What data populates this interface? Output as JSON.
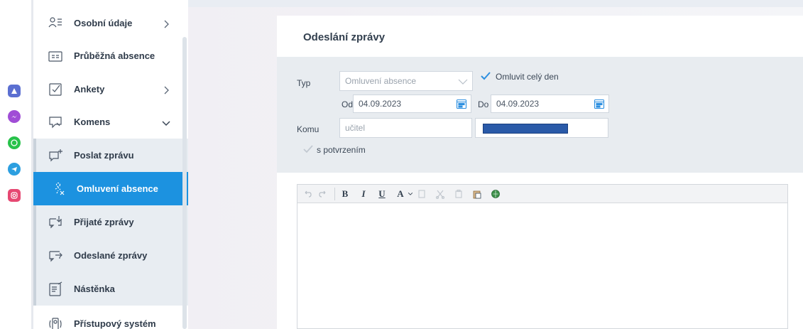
{
  "dock": {
    "apps": [
      {
        "icon": "app-launcher-icon",
        "color": "#5b6fd1"
      },
      {
        "icon": "messenger-icon",
        "color": "#a04dd6"
      },
      {
        "icon": "whatsapp-icon",
        "color": "#27c24a"
      },
      {
        "icon": "telegram-icon",
        "color": "#2c9fe0"
      },
      {
        "icon": "instagram-icon",
        "color": "#e64872"
      }
    ]
  },
  "sidebar": {
    "items": [
      {
        "label": "Osobní údaje",
        "icon": "person-card-icon"
      },
      {
        "label": "Průběžná absence",
        "icon": "id-card-icon"
      },
      {
        "label": "Ankety",
        "icon": "checkbox-icon"
      },
      {
        "label": "Komens",
        "icon": "chat-bubble-icon"
      },
      {
        "label": "Poslat zprávu",
        "icon": "new-message-icon"
      },
      {
        "label": "Omluvení absence",
        "icon": "excuse-absence-icon"
      },
      {
        "label": "Přijaté zprávy",
        "icon": "inbox-icon"
      },
      {
        "label": "Odeslané zprávy",
        "icon": "sent-icon"
      },
      {
        "label": "Nástěnka",
        "icon": "noticeboard-icon"
      },
      {
        "label": "Přístupový systém",
        "icon": "access-system-icon"
      }
    ]
  },
  "panel": {
    "title": "Odeslání zprávy",
    "type_label": "Typ",
    "type_value": "Omluvení absence",
    "full_day_label": "Omluvit celý den",
    "from_label": "Od",
    "from_value": "04.09.2023",
    "to_label": "Do",
    "to_value": "04.09.2023",
    "recipient_label": "Komu",
    "recipient_value": "učitel",
    "confirm_label": "s potvrzením"
  },
  "colors": {
    "accent": "#1c92e0",
    "check": "#2d8fe0"
  },
  "editor": {
    "toolbar": {
      "bold": "B",
      "italic": "I",
      "underline": "U",
      "font_color": "A"
    }
  }
}
